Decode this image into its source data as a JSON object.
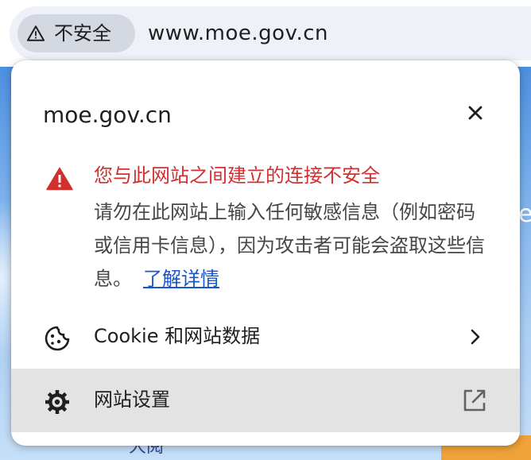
{
  "address_bar": {
    "security_chip_label": "不安全",
    "security_icon": "warning-triangle-icon",
    "url": "www.moe.gov.cn"
  },
  "background_page": {
    "right_partial_text": "ea",
    "bottom_partial_text": "大阅"
  },
  "site_info_popup": {
    "title": "moe.gov.cn",
    "close_icon": "close-icon",
    "warning": {
      "icon": "warning-triangle-icon",
      "heading": "您与此网站之间建立的连接不安全",
      "body": "请勿在此网站上输入任何敏感信息（例如密码或信用卡信息），因为攻击者可能会盗取这些信息。",
      "learn_more": "了解详情"
    },
    "items": [
      {
        "icon": "cookie-icon",
        "label": "Cookie 和网站数据",
        "trailing_icon": "chevron-right-icon"
      },
      {
        "icon": "gear-icon",
        "label": "网站设置",
        "trailing_icon": "open-external-icon"
      }
    ]
  },
  "colors": {
    "warning_red": "#d32f2f",
    "link_blue": "#1a55c9",
    "chip_background": "#d3d8e1",
    "omnibox_background": "#eef1f7",
    "selected_row": "#e3e3e3"
  }
}
